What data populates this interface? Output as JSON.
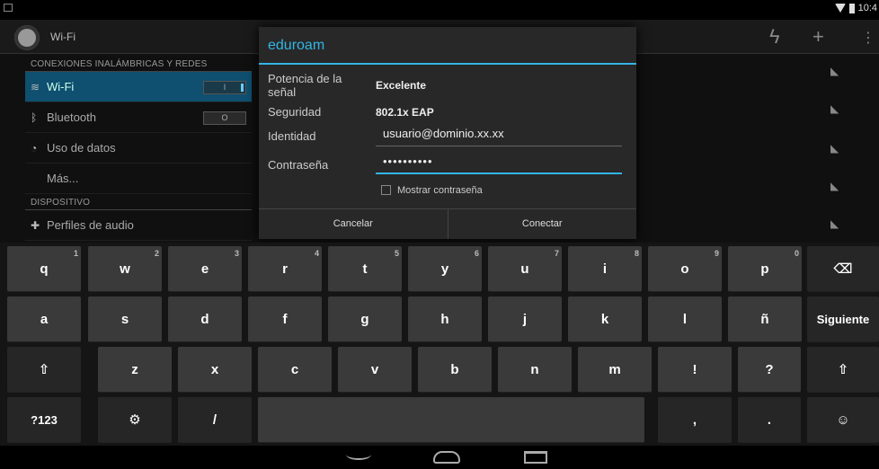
{
  "status_bar": {
    "time": "10:4"
  },
  "settings": {
    "title": "Wi-Fi",
    "sections": [
      {
        "header": "CONEXIONES INALÁMBRICAS Y REDES"
      },
      {
        "header": "DISPOSITIVO"
      }
    ],
    "items": [
      {
        "label": "Wi-Fi",
        "toggle": "I"
      },
      {
        "label": "Bluetooth",
        "toggle": "O"
      },
      {
        "label": "Uso de datos"
      },
      {
        "label": "Más..."
      },
      {
        "label": "Perfiles de audio"
      }
    ]
  },
  "dialog": {
    "title": "eduroam",
    "signal_label": "Potencia de la señal",
    "signal_value": "Excelente",
    "security_label": "Seguridad",
    "security_value": "802.1x EAP",
    "identity_label": "Identidad",
    "identity_value": "usuario@dominio.xx.xx",
    "password_label": "Contraseña",
    "password_value": "••••••••••",
    "show_password_label": "Mostrar contraseña",
    "cancel_label": "Cancelar",
    "connect_label": "Conectar"
  },
  "keyboard": {
    "row1": [
      {
        "k": "q",
        "h": "1"
      },
      {
        "k": "w",
        "h": "2"
      },
      {
        "k": "e",
        "h": "3"
      },
      {
        "k": "r",
        "h": "4"
      },
      {
        "k": "t",
        "h": "5"
      },
      {
        "k": "y",
        "h": "6"
      },
      {
        "k": "u",
        "h": "7"
      },
      {
        "k": "i",
        "h": "8"
      },
      {
        "k": "o",
        "h": "9"
      },
      {
        "k": "p",
        "h": "0"
      }
    ],
    "row2": [
      "a",
      "s",
      "d",
      "f",
      "g",
      "h",
      "j",
      "k",
      "l",
      "ñ"
    ],
    "row3": [
      "z",
      "x",
      "c",
      "v",
      "b",
      "n",
      "m",
      "!",
      "?"
    ],
    "next_label": "Siguiente",
    "symbols_label": "?123",
    "slash": "/",
    "comma": ",",
    "period": ".",
    "shift_glyph": "⇧",
    "backspace_glyph": "⌫",
    "emoji_glyph": "☺",
    "settings_glyph": "⚙"
  }
}
